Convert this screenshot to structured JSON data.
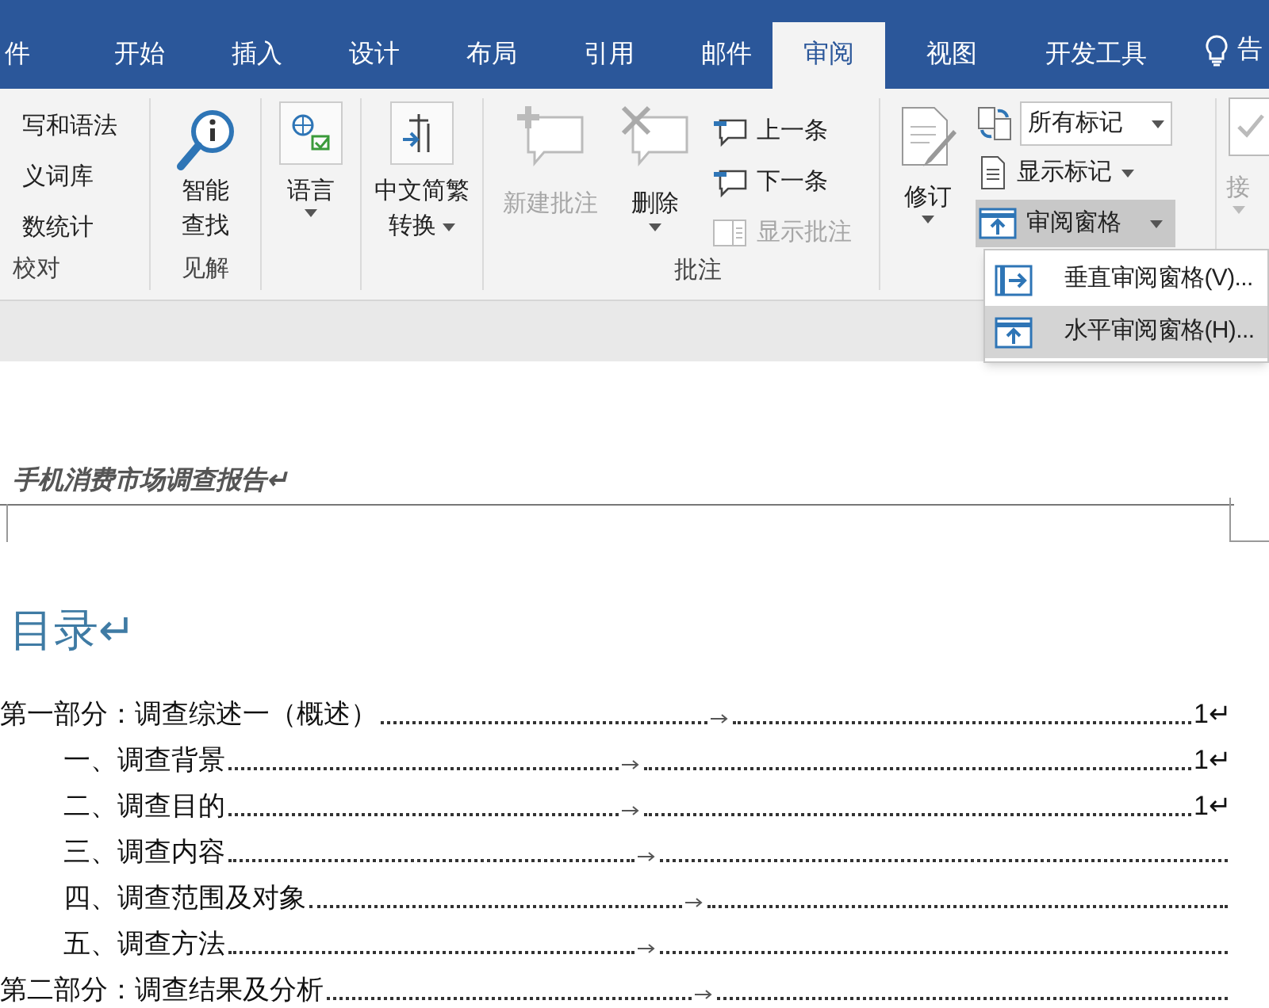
{
  "tabs": [
    {
      "label": "件",
      "selected": false
    },
    {
      "label": "开始",
      "selected": false
    },
    {
      "label": "插入",
      "selected": false
    },
    {
      "label": "设计",
      "selected": false
    },
    {
      "label": "布局",
      "selected": false
    },
    {
      "label": "引用",
      "selected": false
    },
    {
      "label": "邮件",
      "selected": false
    },
    {
      "label": "审阅",
      "selected": true
    },
    {
      "label": "视图",
      "selected": false
    },
    {
      "label": "开发工具",
      "selected": false
    }
  ],
  "tell_me": {
    "label": "告"
  },
  "proofing": {
    "items": [
      "写和语法",
      "义词库",
      "数统计"
    ],
    "label": "校对"
  },
  "insights": {
    "button": [
      "智能",
      "查找"
    ],
    "label": "见解"
  },
  "language": {
    "button": "语言"
  },
  "conversion": {
    "button": [
      "中文简繁",
      "转换"
    ]
  },
  "comments": {
    "new": {
      "label": "新建批注",
      "disabled": true
    },
    "delete": {
      "label": "删除",
      "disabled": false
    },
    "previous": {
      "label": "上一条",
      "disabled": false
    },
    "next": {
      "label": "下一条",
      "disabled": false
    },
    "show": {
      "label": "显示批注",
      "disabled": true
    },
    "label": "批注"
  },
  "tracking": {
    "track_changes": "修订",
    "markup_select": "所有标记",
    "show_markup": "显示标记",
    "reviewing_pane": {
      "label": "审阅窗格",
      "expanded": true
    }
  },
  "accept": {
    "label": "接",
    "disabled": true
  },
  "pane_menu": [
    {
      "label": "垂直审阅窗格(V)...",
      "selected": false
    },
    {
      "label": "水平审阅窗格(H)...",
      "selected": true
    }
  ],
  "document": {
    "header": "手机消费市场调查报告↵",
    "toc_title": "目录↵",
    "toc": [
      {
        "text": "第一部分：调查综述一（概述）",
        "page": "1↵",
        "children": [
          {
            "text": "一、调查背景",
            "page": "1↵"
          },
          {
            "text": "二、调查目的",
            "page": "1↵"
          },
          {
            "text": "三、调查内容"
          },
          {
            "text": "四、调查范围及对象"
          },
          {
            "text": "五、调查方法"
          }
        ]
      },
      {
        "text": "第二部分：调查结果及分析"
      }
    ]
  }
}
